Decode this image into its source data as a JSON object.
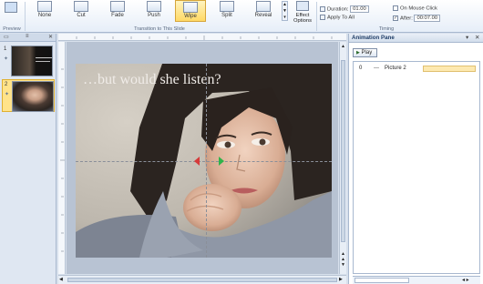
{
  "ribbon": {
    "preview_group_label": "Preview",
    "transitions": [
      {
        "label": "None",
        "selected": false
      },
      {
        "label": "Cut",
        "selected": false
      },
      {
        "label": "Fade",
        "selected": false
      },
      {
        "label": "Push",
        "selected": false
      },
      {
        "label": "Wipe",
        "selected": true
      },
      {
        "label": "Split",
        "selected": false
      },
      {
        "label": "Reveal",
        "selected": false
      }
    ],
    "effect_options_label": "Effect Options",
    "transition_group_label": "Transition to This Slide",
    "duration_label": "Duration:",
    "duration_value": "01.00",
    "apply_all_label": "Apply To All",
    "on_mouse_click_label": "On Mouse Click",
    "after_label": "After:",
    "after_value": "00:07.00",
    "timing_group_label": "Timing"
  },
  "slides_pane": {
    "slides": [
      {
        "number": "1",
        "selected": false
      },
      {
        "number": "2",
        "selected": true
      }
    ]
  },
  "slide": {
    "title": "…but would she listen?"
  },
  "animation_pane": {
    "title": "Animation Pane",
    "play_label": "Play",
    "items": [
      {
        "index": "0",
        "name": "Picture 2"
      }
    ]
  },
  "colors": {
    "selected_transition": "#ffd966",
    "animation_bar": "#fde9b0",
    "pane_header_text": "#1f3d66"
  }
}
